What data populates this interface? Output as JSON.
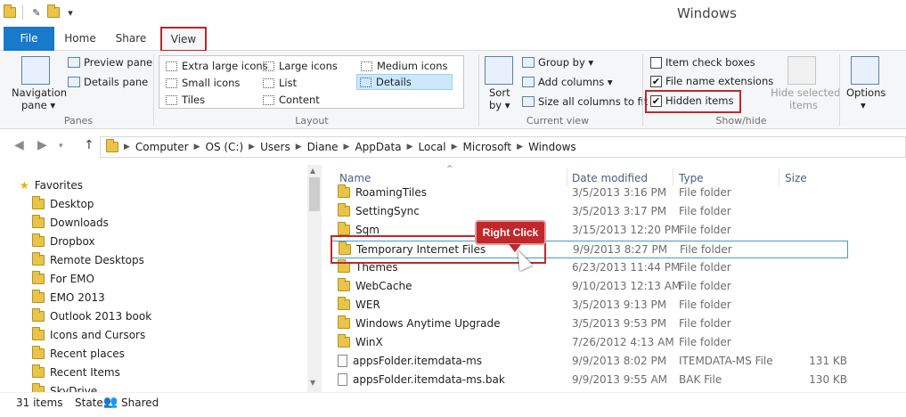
{
  "window": {
    "title": "Windows"
  },
  "tabs": {
    "file": "File",
    "home": "Home",
    "share": "Share",
    "view": "View"
  },
  "ribbon": {
    "panes": {
      "nav_pane_line1": "Navigation",
      "nav_pane_line2": "pane ▾",
      "preview_pane": "Preview pane",
      "details_pane": "Details pane",
      "label": "Panes"
    },
    "layout": {
      "extra_large_icons": "Extra large icons",
      "large_icons": "Large icons",
      "medium_icons": "Medium icons",
      "small_icons": "Small icons",
      "list": "List",
      "details": "Details",
      "tiles": "Tiles",
      "content": "Content",
      "label": "Layout"
    },
    "current_view": {
      "sort_line1": "Sort",
      "sort_line2": "by ▾",
      "group_by": "Group by ▾",
      "add_columns": "Add columns ▾",
      "size_all_columns": "Size all columns to fit",
      "label": "Current view"
    },
    "show_hide": {
      "item_check_boxes": "Item check boxes",
      "file_name_extensions": "File name extensions",
      "hidden_items": "Hidden items",
      "hide_selected_line1": "Hide selected",
      "hide_selected_line2": "items",
      "label": "Show/hide"
    },
    "options": {
      "line1": "Options",
      "line2": "▾"
    }
  },
  "address": {
    "crumbs": [
      "Computer",
      "OS (C:)",
      "Users",
      "Diane",
      "AppData",
      "Local",
      "Microsoft",
      "Windows"
    ]
  },
  "nav_pane": {
    "items": [
      "Favorites",
      "Desktop",
      "Downloads",
      "Dropbox",
      "Remote Desktops",
      "For EMO",
      "EMO 2013",
      "Outlook 2013 book",
      "Icons and Cursors",
      "Recent places",
      "Recent Items",
      "SkyDrive"
    ]
  },
  "file_list": {
    "headers": {
      "name": "Name",
      "date": "Date modified",
      "type": "Type",
      "size": "Size"
    },
    "rows": [
      {
        "name": "RoamingTiles",
        "date": "3/5/2013 3:16 PM",
        "type": "File folder",
        "size": ""
      },
      {
        "name": "SettingSync",
        "date": "3/5/2013 3:17 PM",
        "type": "File folder",
        "size": ""
      },
      {
        "name": "Sqm",
        "date": "3/15/2013 12:20 PM",
        "type": "File folder",
        "size": ""
      },
      {
        "name": "Temporary Internet Files",
        "date": "9/9/2013 8:27 PM",
        "type": "File folder",
        "size": ""
      },
      {
        "name": "Themes",
        "date": "6/23/2013 11:44 PM",
        "type": "File folder",
        "size": ""
      },
      {
        "name": "WebCache",
        "date": "9/10/2013 12:13 AM",
        "type": "File folder",
        "size": ""
      },
      {
        "name": "WER",
        "date": "3/5/2013 9:13 PM",
        "type": "File folder",
        "size": ""
      },
      {
        "name": "Windows Anytime Upgrade",
        "date": "3/5/2013 9:53 PM",
        "type": "File folder",
        "size": ""
      },
      {
        "name": "WinX",
        "date": "7/26/2012 4:13 AM",
        "type": "File folder",
        "size": ""
      },
      {
        "name": "appsFolder.itemdata-ms",
        "date": "9/9/2013 8:02 PM",
        "type": "ITEMDATA-MS File",
        "size": "131 KB"
      },
      {
        "name": "appsFolder.itemdata-ms.bak",
        "date": "9/9/2013 9:55 AM",
        "type": "BAK File",
        "size": "130 KB"
      }
    ]
  },
  "status": {
    "count": "31 items",
    "state_label": "State:",
    "state_value": "Shared"
  },
  "annotation": {
    "callout": "Right Click"
  },
  "colors": {
    "accent": "#1979ca",
    "highlight": "#c0282b"
  }
}
